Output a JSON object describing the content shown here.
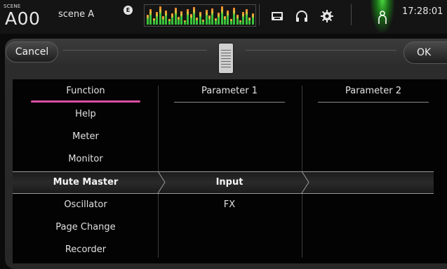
{
  "status_bar": {
    "scene_label": "SCENE",
    "scene_number": "A00",
    "scene_name": "scene A",
    "edit_badge": "E",
    "clock": "17:28:01",
    "icons": [
      "recorder-icon",
      "headphones-icon",
      "settings-gear-icon",
      "user-icon"
    ],
    "user_indicator_color": "#49d63f"
  },
  "dialog": {
    "cancel_label": "Cancel",
    "ok_label": "OK"
  },
  "columns": {
    "function_header": "Function",
    "parameter1_header": "Parameter 1",
    "parameter2_header": "Parameter 2"
  },
  "functions": [
    "Help",
    "Meter",
    "Monitor",
    "Mute Master",
    "Oscillator",
    "Page Change",
    "Recorder"
  ],
  "selected_function": "Mute Master",
  "parameter1": [
    "Input",
    "FX"
  ],
  "selected_parameter1": "Input",
  "accent_color": "#d94fa1"
}
